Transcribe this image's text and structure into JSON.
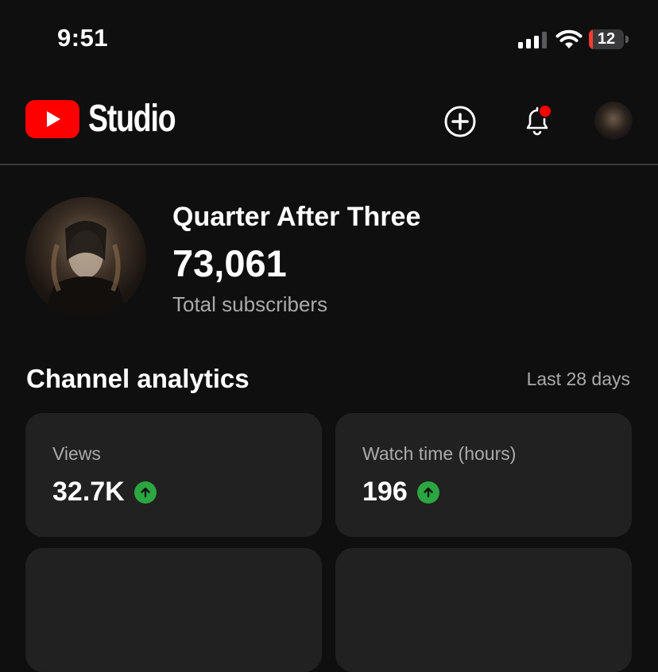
{
  "status_bar": {
    "time": "9:51",
    "battery_level": "12",
    "battery_color": "#ff3b30",
    "icons": [
      "signal-icon",
      "wifi-icon",
      "battery-icon"
    ]
  },
  "header": {
    "app_name": "Studio",
    "logo_color": "#ff0000",
    "icons": [
      "youtube-logo-icon",
      "create-icon",
      "notification-bell-icon",
      "avatar"
    ],
    "notification_dot_color": "#ff0000"
  },
  "channel": {
    "name": "Quarter After Three",
    "subscriber_count": "73,061",
    "subscriber_label": "Total subscribers"
  },
  "analytics": {
    "title": "Channel analytics",
    "period": "Last 28 days",
    "trend_color": "#2ba640",
    "cards": [
      {
        "label": "Views",
        "value": "32.7K",
        "trend": "up"
      },
      {
        "label": "Watch time (hours)",
        "value": "196",
        "trend": "up"
      }
    ]
  }
}
